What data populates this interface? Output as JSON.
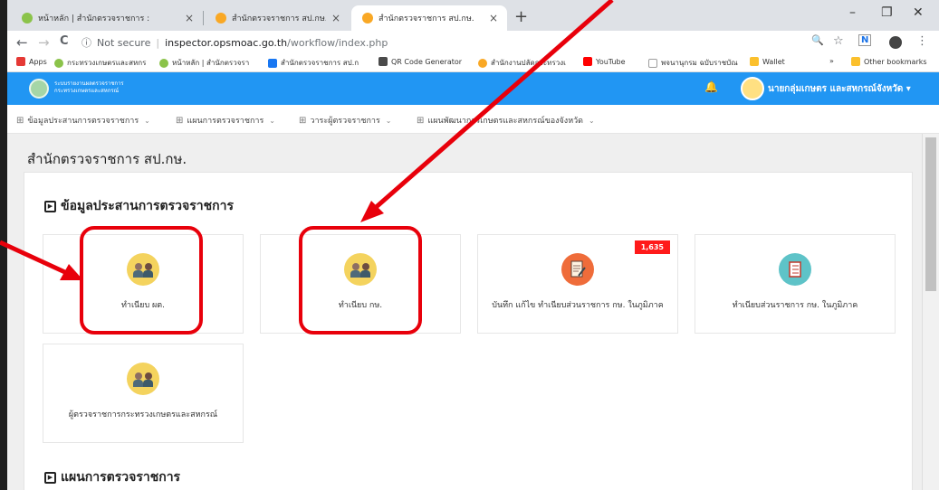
{
  "browser": {
    "tabs": [
      {
        "label": "หน้าหลัก | สำนักตรวจราชการ :"
      },
      {
        "label": "สำนักตรวจราชการ สป.กษ."
      },
      {
        "label": "สำนักตรวจราชการ สป.กษ."
      }
    ],
    "tab_close": "×",
    "new_tab": "+",
    "window": {
      "min": "–",
      "max": "❐",
      "close": "✕"
    },
    "nav": {
      "back": "←",
      "forward": "→",
      "reload": "C"
    },
    "address": {
      "info": "ⓘ",
      "not_secure": "Not secure",
      "host": "inspector.opsmoac.go.th",
      "path": "/workflow/index.php"
    },
    "address_icons": {
      "zoom": "🔍",
      "star": "☆",
      "ext": "N",
      "menu": "⋮"
    },
    "bookmarks": [
      {
        "label": "Apps",
        "color": "#e53935"
      },
      {
        "label": "กระทรวงเกษตรและสหกร",
        "color": "#8bc34a"
      },
      {
        "label": "หน้าหลัก | สำนักตรวจรา",
        "color": "#8bc34a"
      },
      {
        "label": "สำนักตรวจราชการ สป.ก",
        "color": "#1877f2"
      },
      {
        "label": "QR Code Generator",
        "color": "#4a4a4a"
      },
      {
        "label": "สำนักงานปลัดกระทรวงเ",
        "color": "#f9a825"
      },
      {
        "label": "YouTube",
        "color": "#ff0000"
      },
      {
        "label": "พจนานุกรม ฉบับราชบัณ",
        "color": "#9e9e9e"
      },
      {
        "label": "Wallet",
        "color": "#fbc02d"
      }
    ],
    "bookmarks_more": "»",
    "other_bookmarks": "Other bookmarks"
  },
  "app": {
    "name_line1": "ระบบรายงานผลตรวจราชการ",
    "name_line2": "กระทรวงเกษตรและสหกรณ์",
    "user": "นายกลุ่มเกษตร และสหกรณ์จังหวัด ▾",
    "accent": "#2196f3"
  },
  "menu": [
    {
      "label": "ข้อมูลประสานการตรวจราชการ"
    },
    {
      "label": "แผนการตรวจราชการ"
    },
    {
      "label": "วาระผู้ตรวจราชการ"
    },
    {
      "label": "แผนพัฒนาการเกษตรและสหกรณ์ของจังหวัด"
    }
  ],
  "menu_grid_icon": "⊞",
  "menu_caret": "⌄",
  "main": {
    "title": "สำนักตรวจราชการ สป.กษ.",
    "section1": "ข้อมูลประสานการตรวจราชการ",
    "section2": "แผนการตรวจราชการ",
    "section_icon": "▶",
    "cards": [
      {
        "label": "ทำเนียบ ผต.",
        "icon": "people-icon",
        "color": "#f4d35e"
      },
      {
        "label": "ทำเนียบ กษ.",
        "icon": "people-icon",
        "color": "#f4d35e"
      },
      {
        "label": "บันทึก แก้ไข ทำเนียบส่วนราชการ กษ. ในภูมิภาค",
        "icon": "document-edit-icon",
        "color": "#ef6c3a",
        "badge": "1,635"
      },
      {
        "label": "ทำเนียบส่วนราชการ กษ. ในภูมิภาค",
        "icon": "notebook-icon",
        "color": "#5ec3c8"
      },
      {
        "label": "ผู้ตรวจราชการกระทรวงเกษตรและสหกรณ์",
        "icon": "people-icon",
        "color": "#f4d35e"
      }
    ]
  },
  "annotation_color": "#e8000b"
}
